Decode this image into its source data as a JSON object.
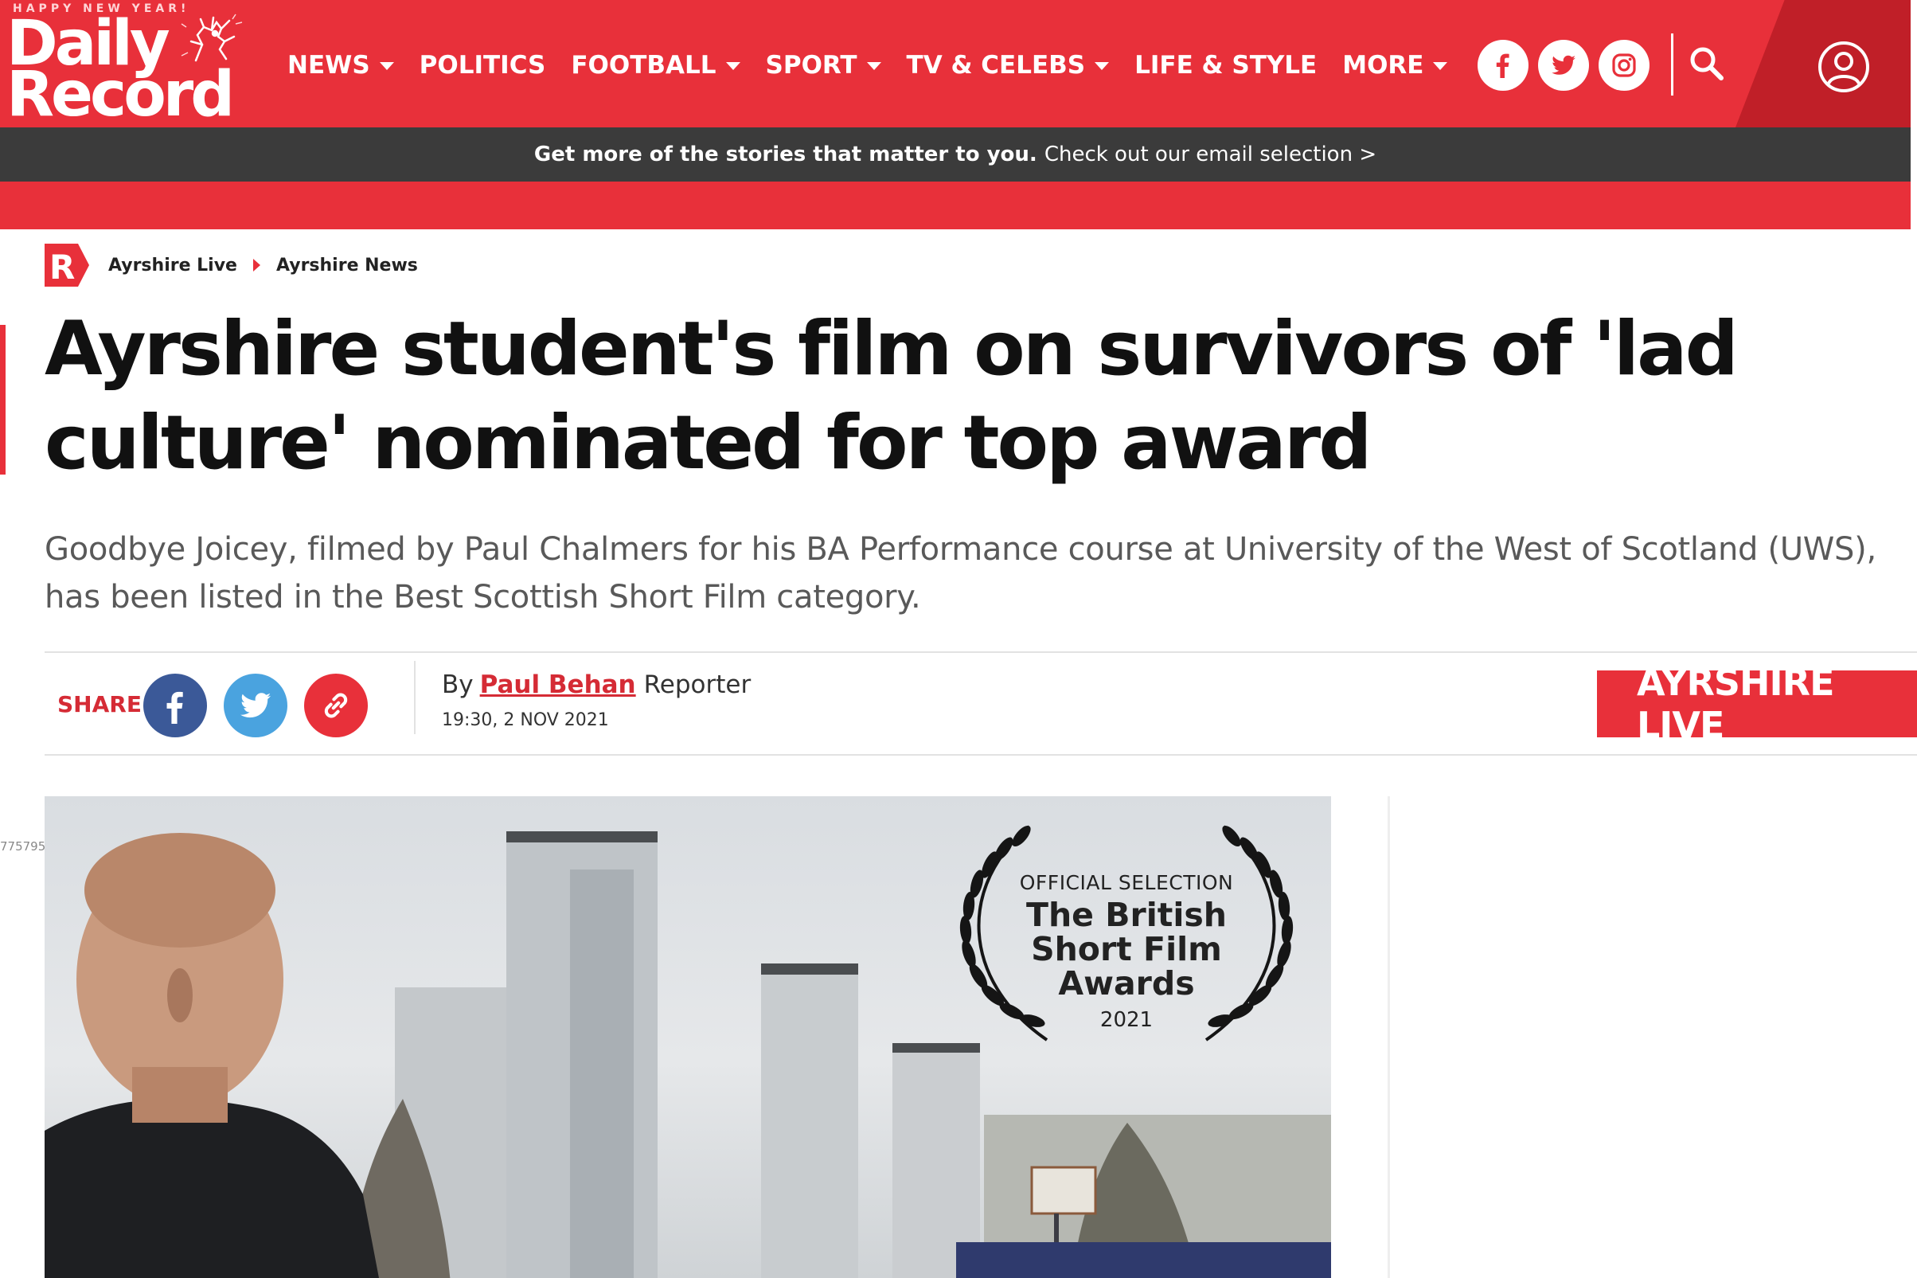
{
  "header": {
    "logo": {
      "tagline": "HAPPY NEW YEAR!",
      "line1": "Daily",
      "line2": "Record"
    },
    "nav": [
      {
        "label": "NEWS",
        "has_menu": true
      },
      {
        "label": "POLITICS",
        "has_menu": false
      },
      {
        "label": "FOOTBALL",
        "has_menu": true
      },
      {
        "label": "SPORT",
        "has_menu": true
      },
      {
        "label": "TV & CELEBS",
        "has_menu": true
      },
      {
        "label": "LIFE & STYLE",
        "has_menu": false
      },
      {
        "label": "MORE",
        "has_menu": true
      }
    ],
    "social_icons": [
      "facebook-icon",
      "twitter-icon",
      "instagram-icon"
    ],
    "search_icon": "search-icon",
    "account_icon": "account-icon",
    "brand_color": "#e8303a"
  },
  "promo": {
    "bold_text": "Get more of the stories that matter to you.",
    "link_text": "Check out our email selection >"
  },
  "breadcrumb": {
    "logo_letter": "R",
    "items": [
      "Ayrshire Live",
      "Ayrshire News"
    ]
  },
  "article": {
    "headline": "Ayrshire student's film on survivors of 'lad culture' nominated for top award",
    "standfirst": "Goodbye Joicey, filmed by Paul Chalmers for his BA Performance course at University of the West of Scotland (UWS), has been listed in the Best Scottish Short Film category.",
    "share_label": "SHARE",
    "share_buttons": [
      {
        "name": "facebook",
        "color": "#3b5998"
      },
      {
        "name": "twitter",
        "color": "#4aa3df"
      },
      {
        "name": "copy-link",
        "color": "#e8303a"
      }
    ],
    "byline_prefix": "By",
    "author": "Paul Behan",
    "author_role": "Reporter",
    "timestamp": "19:30, 2 NOV 2021",
    "section_badge": "AYRSHIRE LIVE"
  },
  "image": {
    "side_caption_id": "775795",
    "award": {
      "line1": "OFFICIAL SELECTION",
      "title_lines": [
        "The British",
        "Short Film",
        "Awards"
      ],
      "year": "2021"
    }
  }
}
